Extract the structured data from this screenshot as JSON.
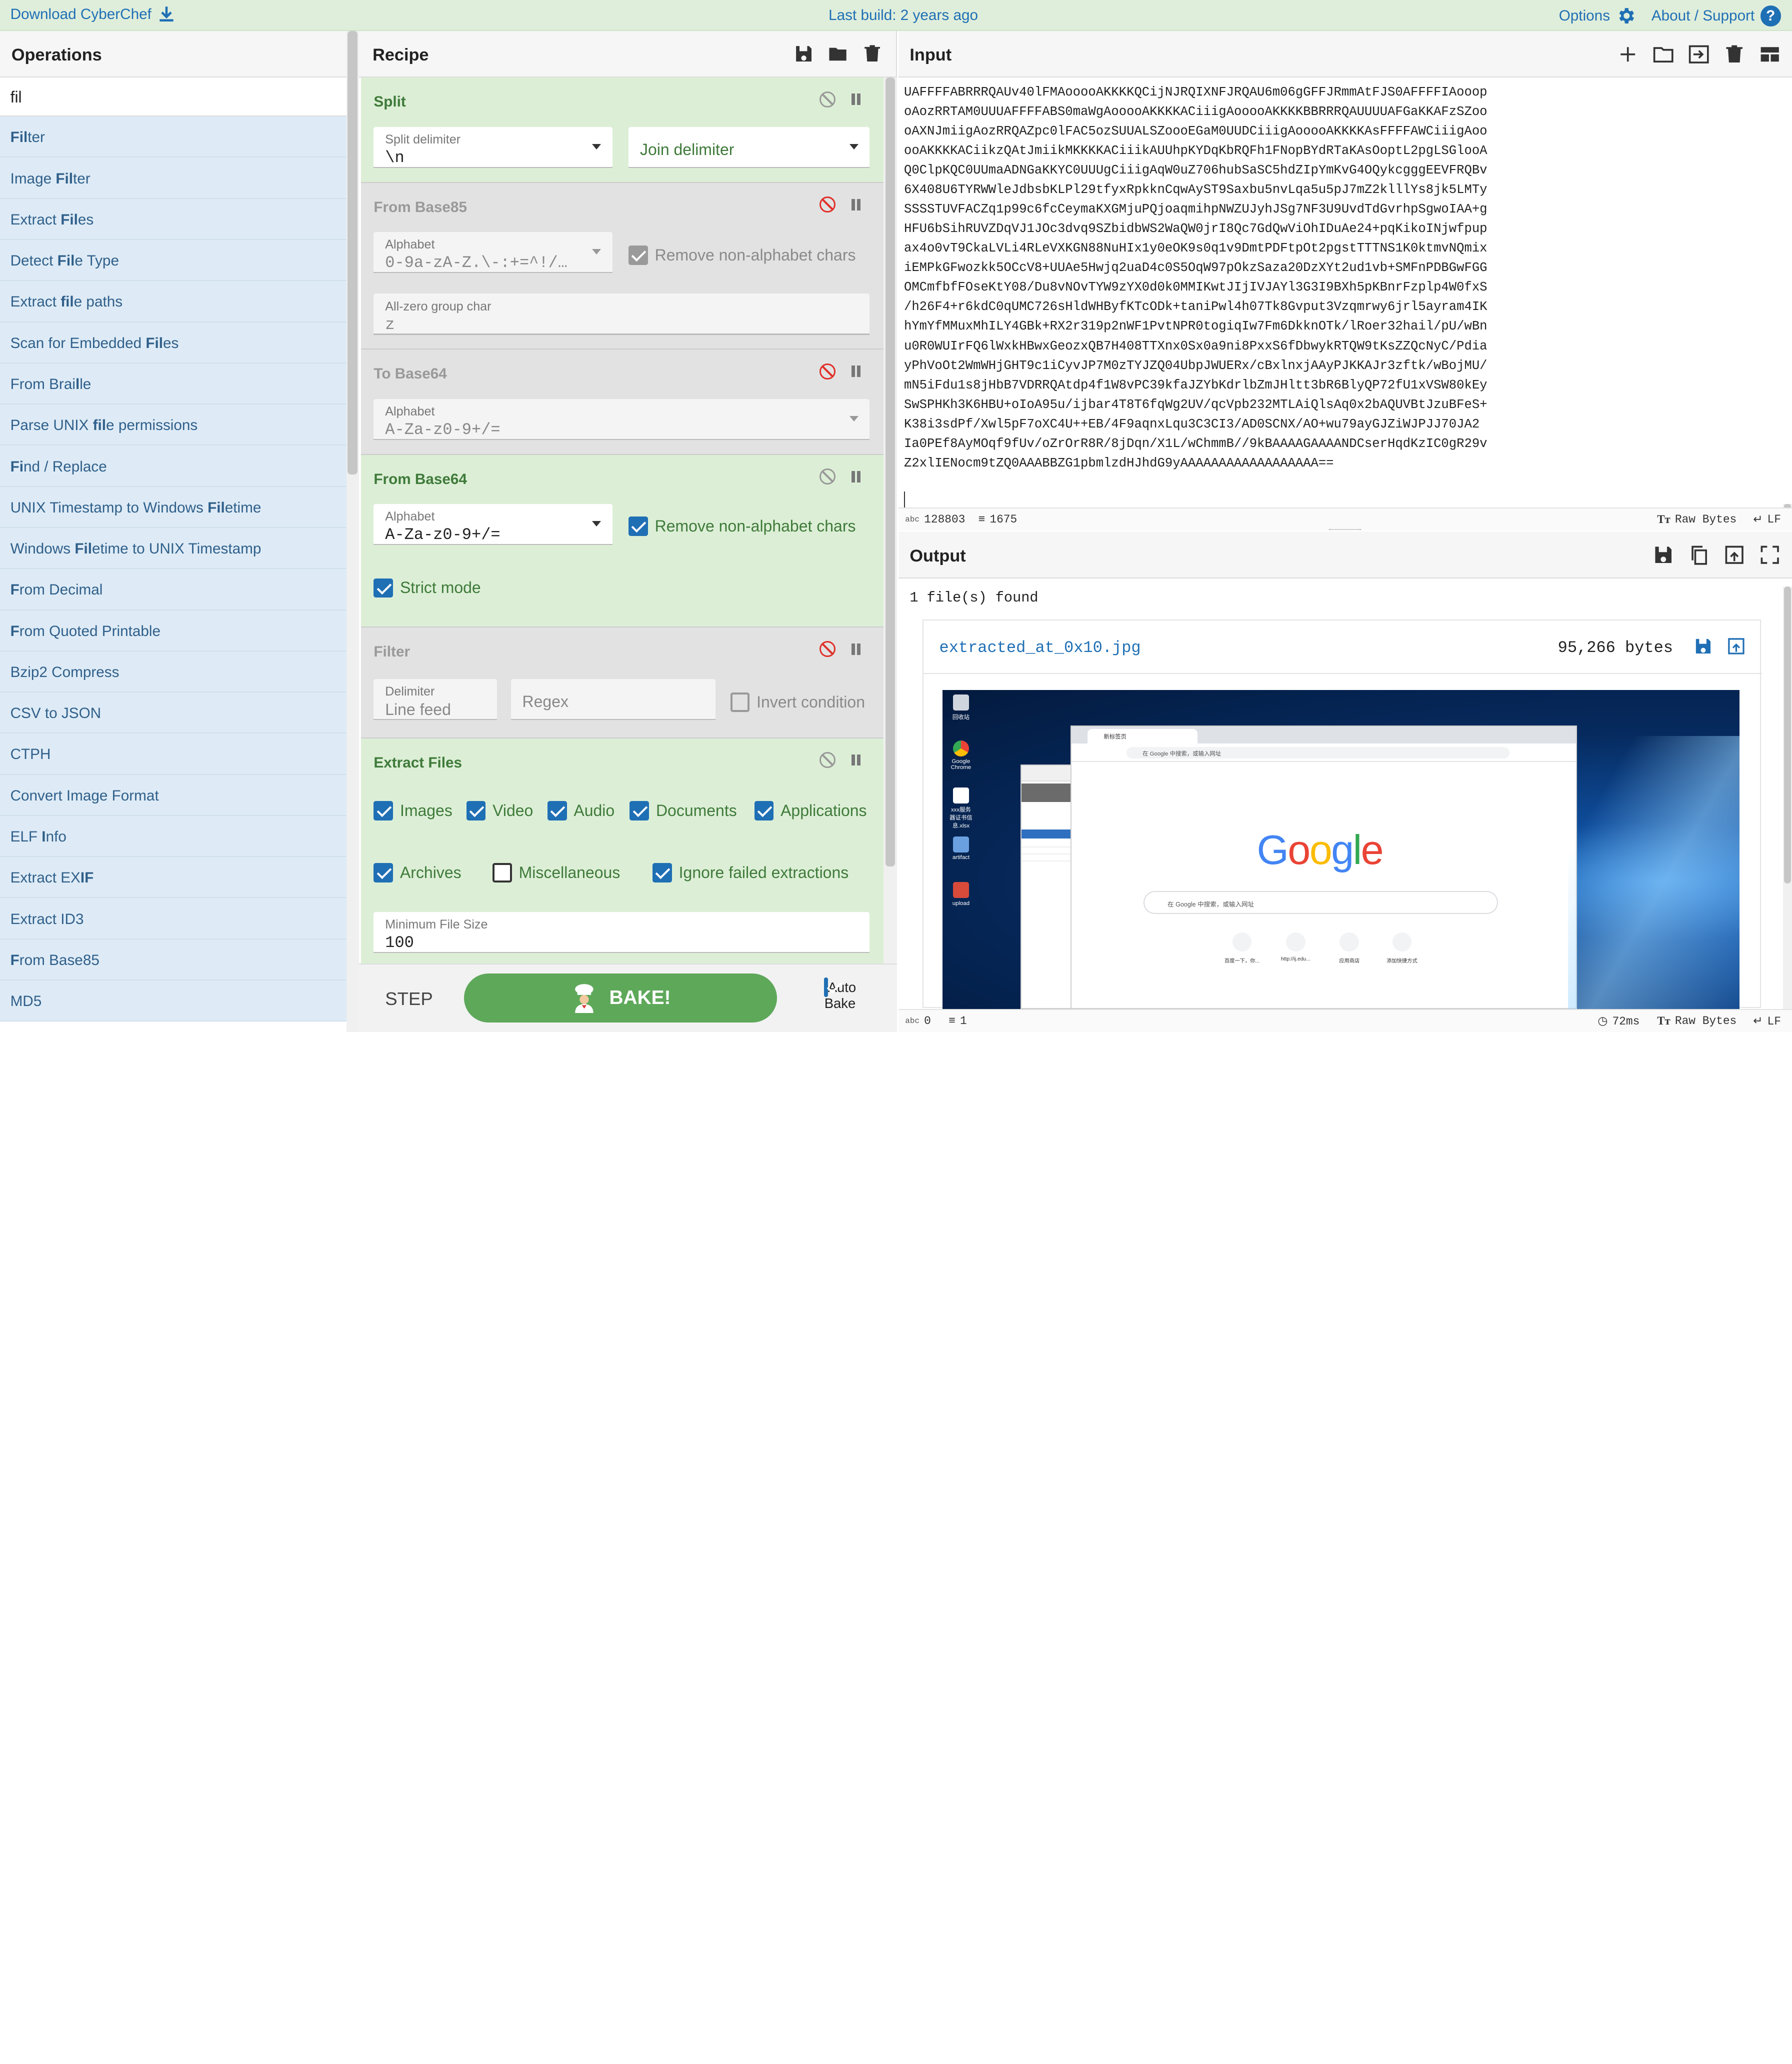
{
  "banner": {
    "download": "Download CyberChef",
    "last_build": "Last build: 2 years ago",
    "options": "Options",
    "about": "About / Support",
    "help_glyph": "?"
  },
  "operations": {
    "title": "Operations",
    "search_value": "fil",
    "items": [
      {
        "pre": "",
        "hl": "Fil",
        "post": "ter"
      },
      {
        "pre": "Image ",
        "hl": "Fil",
        "post": "ter"
      },
      {
        "pre": "Extract ",
        "hl": "Fil",
        "post": "es"
      },
      {
        "pre": "Detect ",
        "hl": "Fil",
        "post": "e Type"
      },
      {
        "pre": "Extract ",
        "hl": "fil",
        "post": "e paths"
      },
      {
        "pre": "Scan for Embedded ",
        "hl": "Fil",
        "post": "es"
      },
      {
        "pre": "From Brai",
        "hl": "l",
        "post": "le"
      },
      {
        "pre": "Parse UNIX ",
        "hl": "fil",
        "post": "e permissions"
      },
      {
        "pre": "",
        "hl": "Fi",
        "post": "nd / Replace"
      },
      {
        "pre": "UNIX Timestamp to Windows ",
        "hl": "Fil",
        "post": "etime"
      },
      {
        "pre": "Windows ",
        "hl": "Fil",
        "post": "etime to UNIX Timestamp"
      },
      {
        "pre": "",
        "hl": "F",
        "post": "rom Decimal"
      },
      {
        "pre": "",
        "hl": "F",
        "post": "rom Quoted Printable"
      },
      {
        "pre": "Bzip2 Compress",
        "hl": "",
        "post": ""
      },
      {
        "pre": "CSV to JSON",
        "hl": "",
        "post": ""
      },
      {
        "pre": "CTPH",
        "hl": "",
        "post": ""
      },
      {
        "pre": "Convert Image Format",
        "hl": "",
        "post": ""
      },
      {
        "pre": "ELF ",
        "hl": "I",
        "post": "nfo"
      },
      {
        "pre": "Extract EX",
        "hl": "IF",
        "post": ""
      },
      {
        "pre": "Extract ID3",
        "hl": "",
        "post": ""
      },
      {
        "pre": "",
        "hl": "F",
        "post": "rom Base85"
      },
      {
        "pre": "MD5",
        "hl": "",
        "post": ""
      }
    ]
  },
  "recipe": {
    "title": "Recipe",
    "split": {
      "title": "Split",
      "split_delim_label": "Split delimiter",
      "split_delim_value": "\\n",
      "join_delim_placeholder": "Join delimiter"
    },
    "from_base85": {
      "title": "From Base85",
      "alphabet_label": "Alphabet",
      "alphabet_value": "0-9a-zA-Z.\\-:+=^!/…",
      "remove_label": "Remove non-alphabet chars",
      "allzero_label": "All-zero group char",
      "allzero_value": "z"
    },
    "to_base64": {
      "title": "To Base64",
      "alphabet_label": "Alphabet",
      "alphabet_value": "A-Za-z0-9+/="
    },
    "from_base64": {
      "title": "From Base64",
      "alphabet_label": "Alphabet",
      "alphabet_value": "A-Za-z0-9+/=",
      "remove_label": "Remove non-alphabet chars",
      "strict_label": "Strict mode"
    },
    "filter": {
      "title": "Filter",
      "delimiter_label": "Delimiter",
      "delimiter_value": "Line feed",
      "regex_placeholder": "Regex",
      "invert_label": "Invert condition"
    },
    "extract_files": {
      "title": "Extract Files",
      "images": "Images",
      "video": "Video",
      "audio": "Audio",
      "documents": "Documents",
      "applications": "Applications",
      "archives": "Archives",
      "misc": "Miscellaneous",
      "ignore_failed": "Ignore failed extractions",
      "min_size_label": "Minimum File Size",
      "min_size_value": "100"
    },
    "step_label": "STEP",
    "bake_label": "BAKE!",
    "autobake_label": "Auto Bake"
  },
  "input": {
    "title": "Input",
    "lines": [
      "UAFFFFABRRRQAUv40lFMAooooAKKKKQCijNJRQIXNFJRQAU6m06gGFFJRmmAtFJS0AFFFFIAooop",
      "oAozRRTAM0UUUAFFFFABS0maWgAooooAKKKKACiiigAooooAKKKKBBRRRQAUUUUAFGaKKAFzSZoo",
      "oAXNJmiigAozRRQAZpc0lFAC5ozSUUALSZoooEGaM0UUDCiiigAooooAKKKKAsFFFFAWCiiigAoo",
      "ooAKKKKACiikzQAtJmiikMKKKKACiiikAUUhpKYDqKbRQFh1FNopBYdRTaKAsOoptL2pgLSGlooA",
      "Q0ClpKQC0UUmaADNGaKKYC0UUUgCiiigAqW0uZ706hubSaSC5hdZIpYmKvG4OQykcgggEEVFRQBv",
      "6X408U6TYRWWleJdbsbKLPl29tfyxRpkknCqwAyST9Saxbu5nvLqa5u5pJ7mZ2klllYs8jk5LMTy",
      "SSSSTUVFACZq1p99c6fcCeymaKXGMjuPQjoaqmihpNWZUJyhJSg7NF3U9UvdTdGvrhpSgwoIAA+g",
      "HFU6bSihRUVZDqVJ1JOc3dvq9SZbidbWS2WaQW0jrI8Qc7GdQwViOhIDuAe24+pqKikoINjwfpup",
      "ax4o0vT9CkaLVLi4RLeVXKGN88NuHIx1y0eOK9s0q1v9DmtPDFtpOt2pgstTTTNS1K0ktmvNQmix",
      "iEMPkGFwozkk5OCcV8+UUAe5Hwjq2uaD4c0S5OqW97pOkzSaza20DzXYt2ud1vb+SMFnPDBGwFGG",
      "OMCmfbfFOseKtY08/Du8vNOvTYW9zYX0d0k0MMIKwtJIjIVJAYl3G3I9BXh5pKBnrFzplp4W0fxS",
      "/h26F4+r6kdC0qUMC726sHldWHByfKTcODk+taniPwl4h07Tk8Gvput3Vzqmrwy6jrl5ayram4IK",
      "hYmYfMMuxMhILY4GBk+RX2r319p2nWF1PvtNPR0togiqIw7Fm6DkknOTk/lRoer32hail/pU/wBn",
      "u0R0WUIrFQ6lWxkHBwxGeozxQB7H408TTXnx0Sx0a9ni8PxxS6fDbwykRTQW9tKsZZQcNyC/Pdia",
      "yPhVoOt2WmWHjGHT9c1iCyvJP7M0zTYJZQ04UbpJWUERx/cBxlnxjAAyPJKKAJr3zftk/wBojMU/",
      "mN5iFdu1s8jHbB7VDRRQAtdp4f1W8vPC39kfaJZYbKdrlbZmJHltt3bR6BlyQP72fU1xVSW80kEy",
      "SwSPHKh3K6HBU+oIoA95u/ijbar4T8T6fqWg2UV/qcVpb232MTLAiQlsAq0x2bAQUVBtJzuBFeS+",
      "K38i3sdPf/Xwl5pF7oXC4U++EB/4F9aqnxLqu3C3CI3/AD0SCNX/AO+wu79ayGJZiWJPJJ70JA2",
      "Ia0PEf8AyMOqf9fUv/oZrOrR8R/8jDqn/X1L/wChmmB//9kBAAAAGAAAANDCserHqdKzIC0gR29v",
      "Z2xlIENocm9tZQ0AAABBZG1pbmlzdHJhdG9yAAAAAAAAAAAAAAAAAA=="
    ],
    "chars": "128803",
    "lines_count": "1675",
    "raw_bytes": "Raw Bytes",
    "line_ending": "LF"
  },
  "output": {
    "title": "Output",
    "found": "1 file(s) found",
    "filename": "extracted_at_0x10.jpg",
    "filesize": "95,266 bytes",
    "chars": "0",
    "lines_count": "1",
    "time": "72ms",
    "raw_bytes": "Raw Bytes",
    "line_ending": "LF",
    "preview": {
      "tab_title": "新标签页",
      "omnibox": "在 Google 中搜索，或输入网址",
      "search_hint": "在 Google 中搜索，或输入网址",
      "logo_letters": [
        "G",
        "o",
        "o",
        "g",
        "l",
        "e"
      ],
      "logo_colors": [
        "#4285f4",
        "#ea4335",
        "#fbbc05",
        "#4285f4",
        "#34a853",
        "#ea4335"
      ],
      "shortcuts": [
        "百度一下，你...",
        "http://ij.edu...",
        "应用商店",
        "添加快捷方式"
      ],
      "desktop_icons": [
        "回收站",
        "Google Chrome",
        "xxx服务器证书信息.xlsx",
        "artifact",
        "upload"
      ]
    }
  },
  "colors": {
    "accent": "#1f6fb5",
    "op_enabled_bg": "#dcefd6",
    "op_disabled_bg": "#e2e2e2",
    "bake": "#5ea85a",
    "ops_item_bg": "#deebf6",
    "disable_red": "#e0302a"
  }
}
